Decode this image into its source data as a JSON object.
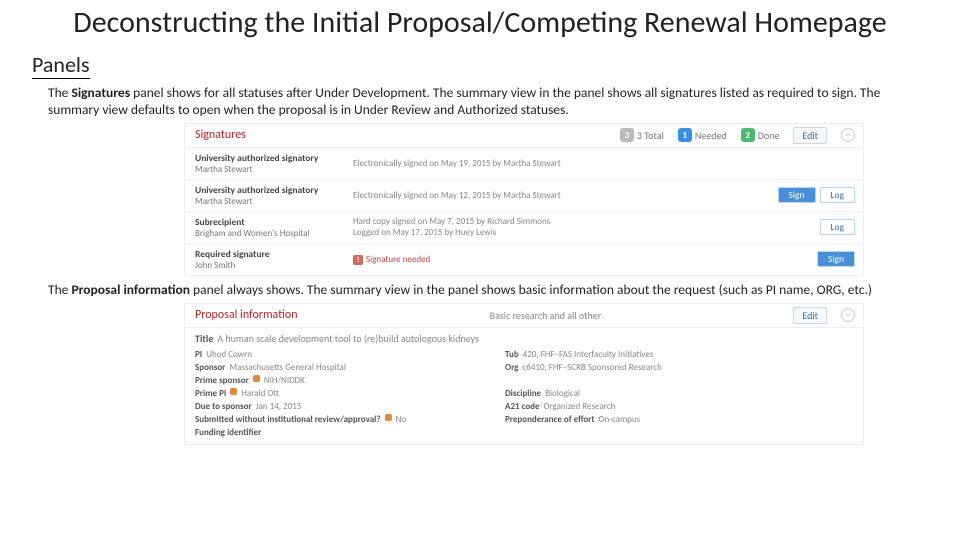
{
  "title": "Deconstructing the Initial Proposal/Competing Renewal Homepage",
  "sectionHead": "Panels",
  "para1_a": "The ",
  "para1_b": "Signatures",
  "para1_c": " panel shows for all statuses after Under Development. The summary view in the panel shows all signatures listed as required to sign. The summary view defaults to open when the proposal is in Under Review and Authorized statuses.",
  "para2_a": "The ",
  "para2_b": "Proposal information",
  "para2_c": " panel always shows. The summary view in the panel shows basic information about the request (such as PI name, ORG, etc.)",
  "sig": {
    "title": "Signatures",
    "total": "3 Total",
    "needed": "Needed",
    "done": "Done",
    "neededCount": "1",
    "doneCount": "2",
    "edit": "Edit",
    "rows": [
      {
        "role": "University authorized signatory",
        "name": "Martha Stewart",
        "status": "Electronically signed on May 19, 2015 by Martha Stewart",
        "buttons": []
      },
      {
        "role": "University authorized signatory",
        "name": "Martha Stewart",
        "status": "Electronically signed on May 12, 2015 by Martha Stewart",
        "buttons": [
          "Sign",
          "Log"
        ]
      },
      {
        "role": "Subrecipient",
        "name": "Brigham and Women's Hospital",
        "status": "Hard copy signed on May 7, 2015 by Richard Simmons\nLogged on May 17, 2015 by Huey Lewis",
        "buttons": [
          "Log"
        ]
      },
      {
        "role": "Required signature",
        "name": "John Smith",
        "status_warn": "Signature needed",
        "buttons": [
          "Sign"
        ]
      }
    ]
  },
  "pi": {
    "title": "Proposal information",
    "subhead": "Basic research and all other",
    "edit": "Edit",
    "projTitle": {
      "label": "Title",
      "value": "A human scale development tool to (re)build autologous kidneys"
    },
    "left": [
      {
        "k": "PI",
        "v": "Uhod Cowrn",
        "link": true
      },
      {
        "k": "Sponsor",
        "v": "Massachusetts General Hospital"
      },
      {
        "k": "Prime sponsor",
        "v": "NIH/NIDDK",
        "bullet": true,
        "link": true
      },
      {
        "k": "Prime PI",
        "v": "Harald Ott",
        "bullet": true,
        "link": true
      },
      {
        "k": "Due to sponsor",
        "v": "Jan 14, 2015"
      },
      {
        "k": "Submitted without institutional review/approval?",
        "v": "No",
        "bullet": true
      },
      {
        "k": "Funding identifier",
        "v": ""
      }
    ],
    "right": [
      {
        "k": "Tub",
        "v": "420, FHF−FAS Interfaculty Initiatives"
      },
      {
        "k": "Org",
        "v": "c6410, FHF−SCRB Sponsored Research"
      },
      {
        "k": "",
        "v": ""
      },
      {
        "k": "Discipline",
        "v": "Biological"
      },
      {
        "k": "A21 code",
        "v": "Organized Research"
      },
      {
        "k": "Preponderance of effort",
        "v": "On-campus"
      }
    ]
  }
}
